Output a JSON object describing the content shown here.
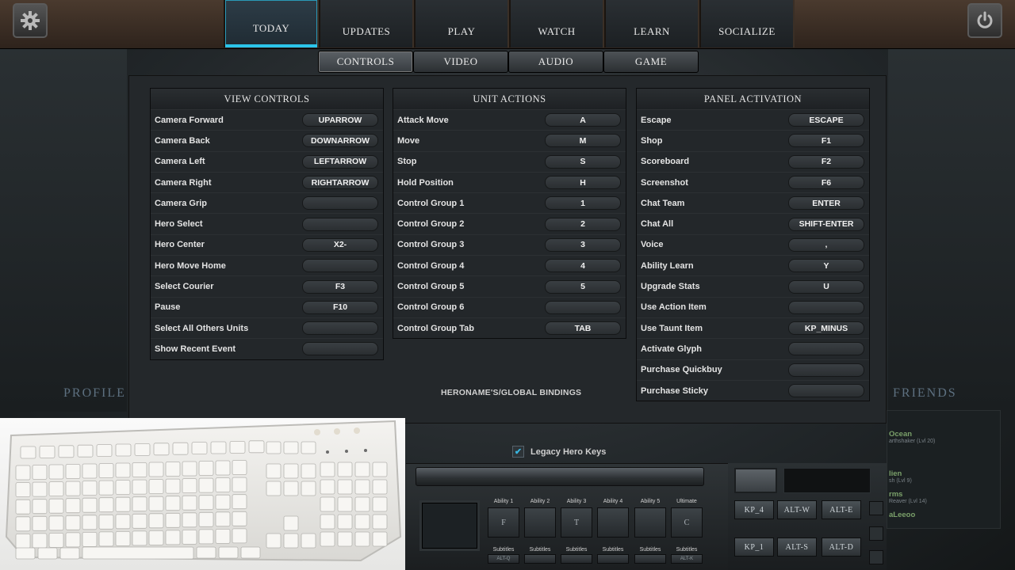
{
  "nav": {
    "tabs": [
      "TODAY",
      "UPDATES",
      "PLAY",
      "WATCH",
      "LEARN",
      "SOCIALIZE"
    ],
    "active": "TODAY"
  },
  "subtabs": {
    "tabs": [
      "CONTROLS",
      "VIDEO",
      "AUDIO",
      "GAME"
    ],
    "active": "CONTROLS"
  },
  "view_controls": {
    "title": "VIEW CONTROLS",
    "rows": [
      {
        "label": "Camera Forward",
        "key": "UPARROW"
      },
      {
        "label": "Camera Back",
        "key": "DOWNARROW"
      },
      {
        "label": "Camera Left",
        "key": "LEFTARROW"
      },
      {
        "label": "Camera Right",
        "key": "RIGHTARROW"
      },
      {
        "label": "Camera Grip",
        "key": ""
      },
      {
        "label": "Hero Select",
        "key": ""
      },
      {
        "label": "Hero Center",
        "key": "X2-"
      },
      {
        "label": "Hero Move Home",
        "key": ""
      },
      {
        "label": "Select Courier",
        "key": "F3"
      },
      {
        "label": "Pause",
        "key": "F10"
      },
      {
        "label": "Select All Others Units",
        "key": ""
      },
      {
        "label": "Show Recent Event",
        "key": ""
      }
    ]
  },
  "unit_actions": {
    "title": "UNIT ACTIONS",
    "rows": [
      {
        "label": "Attack Move",
        "key": "A"
      },
      {
        "label": "Move",
        "key": "M"
      },
      {
        "label": "Stop",
        "key": "S"
      },
      {
        "label": "Hold Position",
        "key": "H"
      },
      {
        "label": "Control Group 1",
        "key": "1"
      },
      {
        "label": "Control Group 2",
        "key": "2"
      },
      {
        "label": "Control Group 3",
        "key": "3"
      },
      {
        "label": "Control Group 4",
        "key": "4"
      },
      {
        "label": "Control Group 5",
        "key": "5"
      },
      {
        "label": "Control Group 6",
        "key": ""
      },
      {
        "label": "Control Group Tab",
        "key": "TAB"
      }
    ]
  },
  "panel_activation": {
    "title": "PANEL ACTIVATION",
    "rows": [
      {
        "label": "Escape",
        "key": "ESCAPE"
      },
      {
        "label": "Shop",
        "key": "F1"
      },
      {
        "label": "Scoreboard",
        "key": "F2"
      },
      {
        "label": "Screenshot",
        "key": "F6"
      },
      {
        "label": "Chat Team",
        "key": "ENTER"
      },
      {
        "label": "Chat All",
        "key": "SHIFT-ENTER"
      },
      {
        "label": "Voice",
        "key": ","
      },
      {
        "label": "Ability Learn",
        "key": "Y"
      },
      {
        "label": "Upgrade Stats",
        "key": "U"
      },
      {
        "label": "Use Action Item",
        "key": ""
      },
      {
        "label": "Use Taunt Item",
        "key": "KP_MINUS"
      },
      {
        "label": "Activate Glyph",
        "key": ""
      },
      {
        "label": "Purchase Quickbuy",
        "key": ""
      },
      {
        "label": "Purchase Sticky",
        "key": ""
      }
    ]
  },
  "hero_bindings_label": "HERONAME'S/GLOBAL BINDINGS",
  "legacy": {
    "label": "Legacy Hero Keys",
    "checked": true
  },
  "side": {
    "profile": "PROFILE",
    "friends": "FRIENDS"
  },
  "friends": [
    {
      "name": "Ocean",
      "sub": "arthshaker (Lvl 20)"
    },
    {
      "name": "lien",
      "sub": "sh (Lvl 9)"
    },
    {
      "name": "rms",
      "sub": "Reaver (Lvl 14)"
    },
    {
      "name": "aLeeoo",
      "sub": ""
    }
  ],
  "abilities": [
    {
      "label": "Ability 1",
      "key": "F",
      "subtitle": "Subtitles",
      "sub_key": "ALT-Q"
    },
    {
      "label": "Ability 2",
      "key": "",
      "subtitle": "Subtitles",
      "sub_key": ""
    },
    {
      "label": "Ability 3",
      "key": "T",
      "subtitle": "Subtitles",
      "sub_key": ""
    },
    {
      "label": "Ability 4",
      "key": "",
      "subtitle": "Subtitles",
      "sub_key": ""
    },
    {
      "label": "Ability 5",
      "key": "",
      "subtitle": "Subtitles",
      "sub_key": ""
    },
    {
      "label": "Ultimate",
      "key": "C",
      "subtitle": "Subtitles",
      "sub_key": "ALT-K"
    }
  ],
  "items": [
    "KP_4",
    "ALT-W",
    "ALT-E",
    "KP_1",
    "ALT-S",
    "ALT-D"
  ],
  "colors": {
    "accent": "#2bc4ea",
    "checkbox": "#39b6e0",
    "friend_name": "#7aa06a"
  },
  "icons": {
    "settings": "gear-icon",
    "power": "power-icon"
  }
}
